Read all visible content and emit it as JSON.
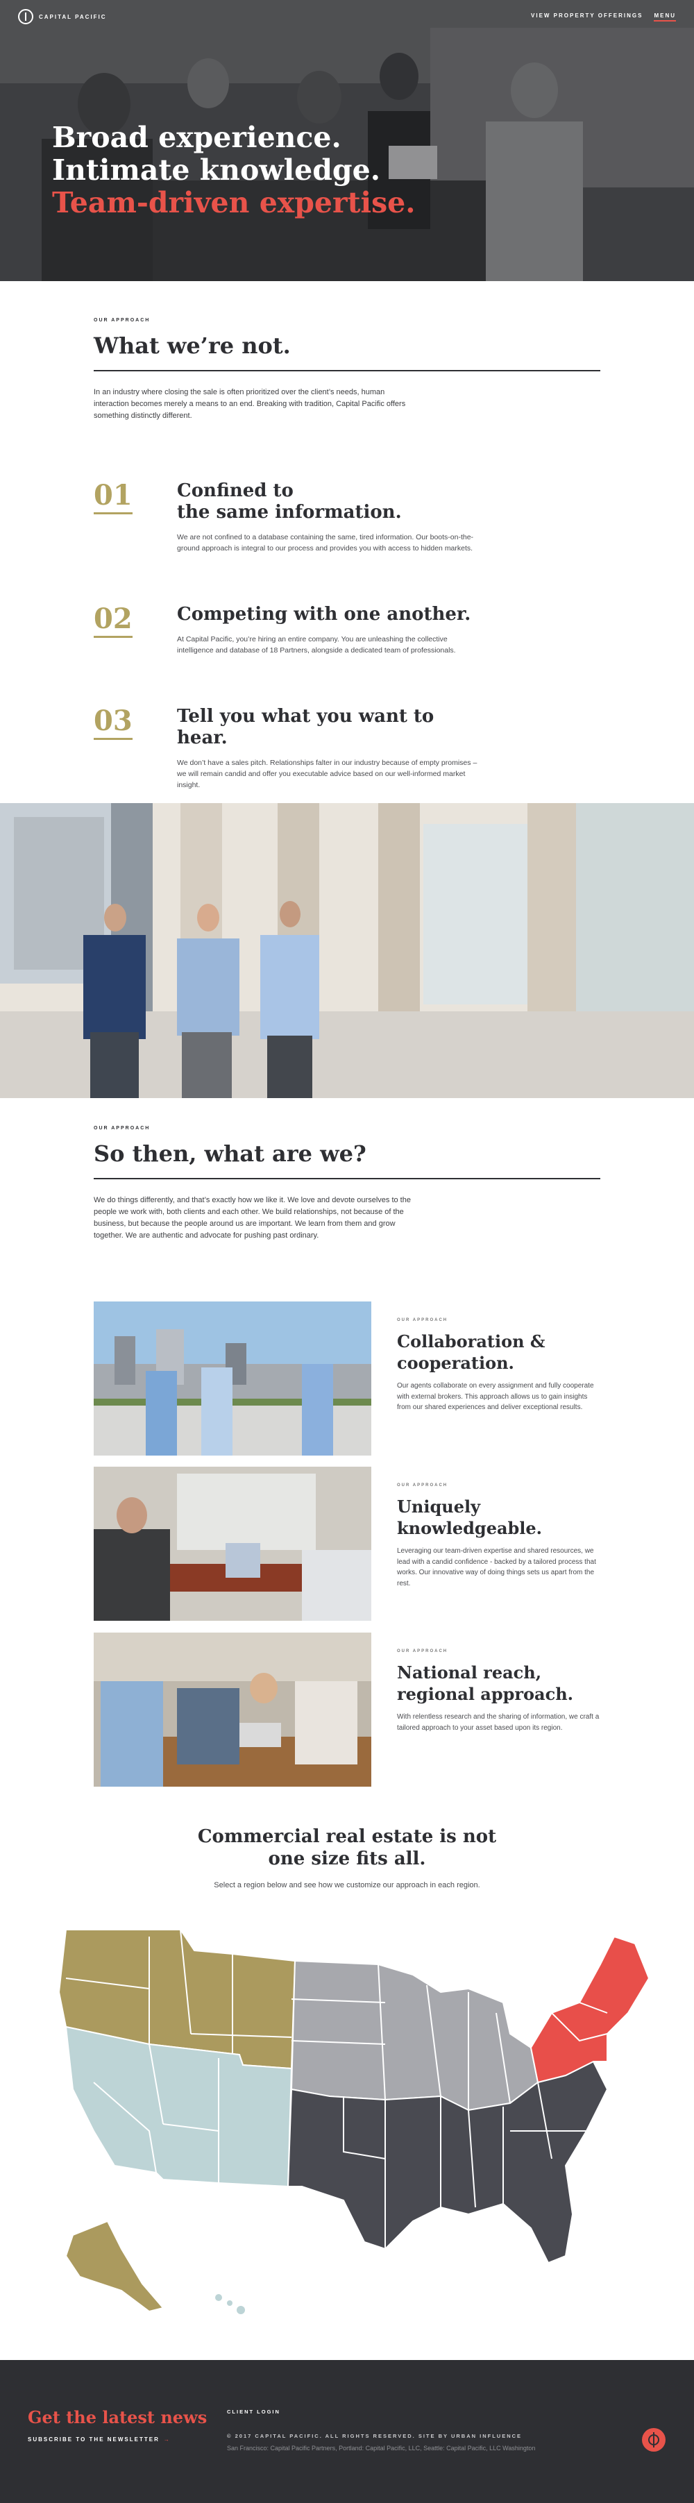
{
  "header": {
    "logo_text": "CAPITAL PACIFIC",
    "nav": {
      "offerings": "VIEW PROPERTY OFFERINGS",
      "menu": "MENU"
    }
  },
  "hero": {
    "line1": "Broad experience.",
    "line2": "Intimate knowledge.",
    "line3": "Team-driven expertise."
  },
  "not_section": {
    "eyebrow": "OUR APPROACH",
    "title": "What we’re not.",
    "intro": "In an industry where closing the sale is often prioritized over the client’s needs, human interaction becomes merely a means to an end. Breaking with tradition, Capital Pacific offers something distinctly different.",
    "points": [
      {
        "num": "01",
        "title_line1": "Confined to",
        "title_line2": "the same information.",
        "text": "We are not confined to a database containing the same, tired information. Our boots-on-the-ground approach is integral to our process and provides you with access to hidden markets."
      },
      {
        "num": "02",
        "title_line1": "Competing with one another.",
        "title_line2": "",
        "text": "At Capital Pacific, you’re hiring an entire company. You are unleashing the collective intelligence and database of 18 Partners, alongside a dedicated team of professionals."
      },
      {
        "num": "03",
        "title_line1": "Tell you what you want to hear.",
        "title_line2": "",
        "text": "We don’t have a sales pitch. Relationships falter in our industry because of empty promises – we will remain candid and offer you executable advice based on our well-informed market insight."
      }
    ]
  },
  "are_section": {
    "eyebrow": "OUR APPROACH",
    "title": "So then, what are we?",
    "intro": "We do things differently, and that’s exactly how we like it. We love and devote ourselves to the people we work with, both clients and each other. We build relationships, not because of the business, but because the people around us are important. We learn from them and grow together. We are authentic and advocate for pushing past ordinary.",
    "features": [
      {
        "eyebrow": "OUR APPROACH",
        "title_line1": "Collaboration &",
        "title_line2": "cooperation.",
        "text": "Our agents collaborate on every assignment and fully cooperate with external brokers. This approach allows us to gain insights from our shared experiences and deliver exceptional results."
      },
      {
        "eyebrow": "OUR APPROACH",
        "title_line1": "Uniquely",
        "title_line2": "knowledgeable.",
        "text": "Leveraging our team-driven expertise and shared resources, we lead with a candid confidence - backed by a tailored process that works. Our innovative way of doing things sets us apart from the rest."
      },
      {
        "eyebrow": "OUR APPROACH",
        "title_line1": "National reach,",
        "title_line2": "regional approach.",
        "text": "With relentless research and the sharing of information, we craft a tailored approach to your asset based upon its region."
      }
    ]
  },
  "map_section": {
    "title_line1": "Commercial real estate is not",
    "title_line2": "one size fits all.",
    "subtitle": "Select a region below and see how we customize our approach in each region.",
    "colors": {
      "northwest": "#ab9a5e",
      "southwest": "#bdd4d6",
      "midwest": "#a7a8ad",
      "southeast": "#494a51",
      "northeast": "#e84f4a"
    }
  },
  "footer": {
    "news": "Get the latest news",
    "subscribe": "SUBSCRIBE TO THE NEWSLETTER",
    "subscribe_arrow": "→",
    "client_login": "CLIENT LOGIN",
    "copyright": "© 2017 CAPITAL PACIFIC. ALL RIGHTS RESERVED. SITE BY URBAN INFLUENCE",
    "offices": "San Francisco: Capital Pacific Partners, Portland: Capital Pacific, LLC, Seattle: Capital Pacific, LLC Washington"
  },
  "theme": {
    "accent": "#e8534a",
    "gold": "#b2a361",
    "dark": "#2e2f33"
  }
}
